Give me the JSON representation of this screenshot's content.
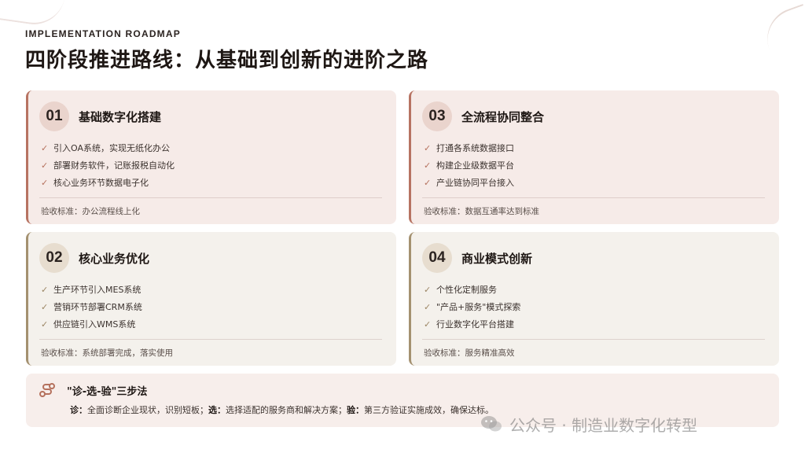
{
  "header": {
    "eyebrow": "IMPLEMENTATION ROADMAP",
    "title": "四阶段推进路线：从基础到创新的进阶之路"
  },
  "phases": [
    {
      "number": "01",
      "title": "基础数字化搭建",
      "items": [
        "引入OA系统，实现无纸化办公",
        "部署财务软件，记账报税自动化",
        "核心业务环节数据电子化"
      ],
      "criteria": "验收标准：办公流程线上化"
    },
    {
      "number": "02",
      "title": "核心业务优化",
      "items": [
        "生产环节引入MES系统",
        "营销环节部署CRM系统",
        "供应链引入WMS系统"
      ],
      "criteria": "验收标准：系统部署完成，落实使用"
    },
    {
      "number": "03",
      "title": "全流程协同整合",
      "items": [
        "打通各系统数据接口",
        "构建企业级数据平台",
        "产业链协同平台接入"
      ],
      "criteria": "验收标准：数据互通率达到标准"
    },
    {
      "number": "04",
      "title": "商业模式创新",
      "items": [
        "个性化定制服务",
        "\"产品+服务\"模式探索",
        "行业数字化平台搭建"
      ],
      "criteria": "验收标准：服务精准高效"
    }
  ],
  "method": {
    "title": "\"诊-选-验\"三步法",
    "steps": [
      {
        "key": "诊：",
        "text": "全面诊断企业现状，识别短板；"
      },
      {
        "key": "选：",
        "text": "选择适配的服务商和解决方案；"
      },
      {
        "key": "验：",
        "text": "第三方验证实施成效，确保达标。"
      }
    ]
  },
  "watermark": {
    "text": "公众号 · 制造业数字化转型"
  },
  "icons": {
    "check": "checkmark-icon",
    "method": "route-icon",
    "watermark": "wechat-icon"
  },
  "colors": {
    "rose_bg": "#f6ebe8",
    "rose_accent": "#b77362",
    "sand_bg": "#f4f1ec",
    "sand_accent": "#a49170"
  }
}
